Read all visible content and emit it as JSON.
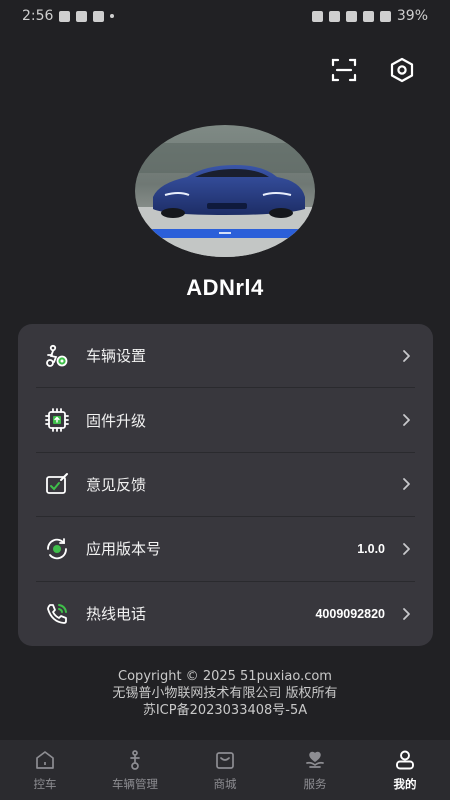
{
  "status_bar": {
    "time": "2:56",
    "battery": "39%"
  },
  "top_actions": {
    "scan_icon": "scan-icon",
    "settings_icon": "hexagon-settings-icon"
  },
  "profile": {
    "username": "ADNrl4"
  },
  "menu": {
    "items": [
      {
        "label": "车辆设置",
        "value": "",
        "icon": "vehicle-settings-icon"
      },
      {
        "label": "固件升级",
        "value": "",
        "icon": "firmware-chip-icon"
      },
      {
        "label": "意见反馈",
        "value": "",
        "icon": "feedback-edit-icon"
      },
      {
        "label": "应用版本号",
        "value": "1.0.0",
        "icon": "version-refresh-icon"
      },
      {
        "label": "热线电话",
        "value": "4009092820",
        "icon": "phone-icon"
      }
    ]
  },
  "footer": {
    "line1": "Copyright © 2025  51puxiao.com",
    "line2": "无锡普小物联网技术有限公司 版权所有",
    "line3": "苏ICP备2023033408号-5A"
  },
  "tabbar": {
    "tabs": [
      {
        "label": "控车",
        "active": false
      },
      {
        "label": "车辆管理",
        "active": false
      },
      {
        "label": "商城",
        "active": false
      },
      {
        "label": "服务",
        "active": false
      },
      {
        "label": "我的",
        "active": true
      }
    ]
  },
  "colors": {
    "background": "#212124",
    "card": "#38373d",
    "accent_green": "#3fbf4a",
    "tabbar": "#2b2b2f"
  }
}
